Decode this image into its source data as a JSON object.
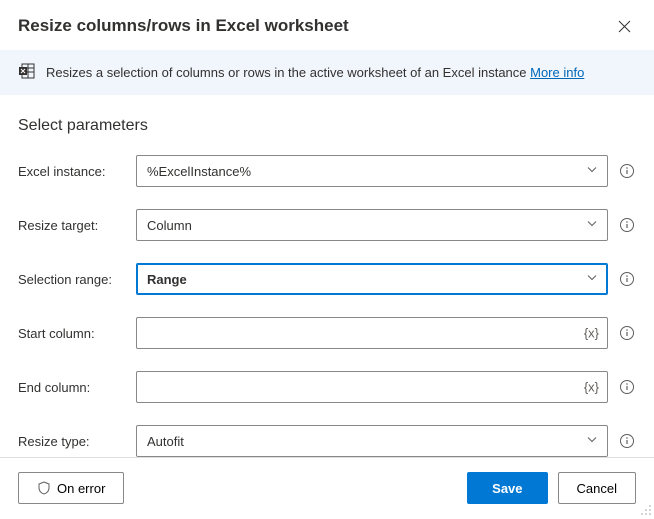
{
  "header": {
    "title": "Resize columns/rows in Excel worksheet"
  },
  "banner": {
    "text": "Resizes a selection of columns or rows in the active worksheet of an Excel instance ",
    "link": "More info"
  },
  "section": {
    "title": "Select parameters"
  },
  "fields": {
    "excel_instance": {
      "label": "Excel instance:",
      "value": "%ExcelInstance%"
    },
    "resize_target": {
      "label": "Resize target:",
      "value": "Column"
    },
    "selection_range": {
      "label": "Selection range:",
      "value": "Range"
    },
    "start_column": {
      "label": "Start column:",
      "value": ""
    },
    "end_column": {
      "label": "End column:",
      "value": ""
    },
    "resize_type": {
      "label": "Resize type:",
      "value": "Autofit"
    }
  },
  "footer": {
    "on_error": "On error",
    "save": "Save",
    "cancel": "Cancel"
  }
}
